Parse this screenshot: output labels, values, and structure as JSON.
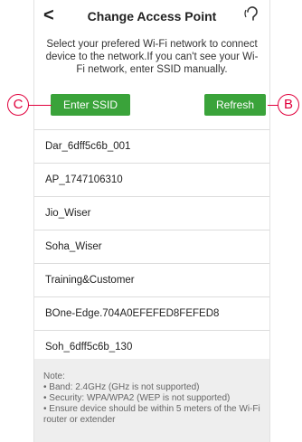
{
  "header": {
    "title": "Change Access Point",
    "back_icon": "<"
  },
  "description": "Select your prefered Wi-Fi network to connect device to the network.If you can't see your Wi-Fi network, enter SSID manually.",
  "buttons": {
    "enter_ssid": "Enter SSID",
    "refresh": "Refresh"
  },
  "callouts": {
    "left": "C",
    "right": "B"
  },
  "networks": [
    "Dar_6dff5c6b_001",
    "AP_1747106310",
    "Jio_Wiser",
    "Soha_Wiser",
    "Training&Customer",
    "BOne-Edge.704A0EFEFED8FEFED8",
    "Soh_6dff5c6b_130"
  ],
  "note": {
    "heading": "Note:",
    "lines": [
      "• Band: 2.4GHz (GHz is not supported)",
      "• Security: WPA/WPA2 (WEP is not supported)",
      "• Ensure device should be within 5 meters of the Wi-Fi router or extender"
    ]
  },
  "colors": {
    "accent": "#3aa33a",
    "callout": "#e0003c"
  }
}
